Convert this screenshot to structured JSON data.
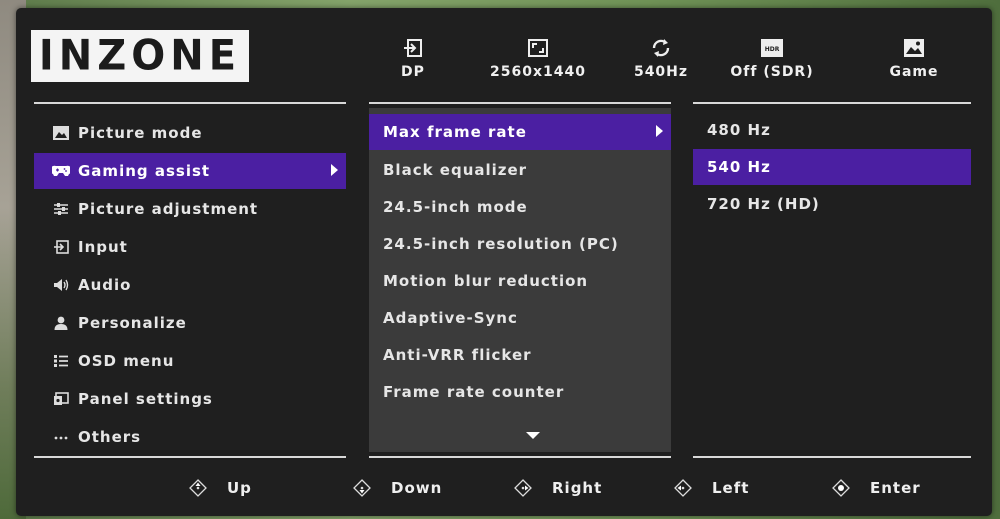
{
  "brand": {
    "logo_text": "INZONE"
  },
  "status_bar": [
    {
      "icon": "input-icon",
      "label": "DP"
    },
    {
      "icon": "resolution-icon",
      "label": "2560x1440"
    },
    {
      "icon": "refresh-rate-icon",
      "label": "540Hz"
    },
    {
      "icon": "hdr-icon",
      "badge": "HDR",
      "label": "Off (SDR)"
    },
    {
      "icon": "picture-mode-icon",
      "label": "Game"
    }
  ],
  "main_menu": {
    "items": [
      {
        "icon": "picture-icon",
        "label": "Picture mode"
      },
      {
        "icon": "gamepad-icon",
        "label": "Gaming assist",
        "selected": true
      },
      {
        "icon": "sliders-icon",
        "label": "Picture adjustment"
      },
      {
        "icon": "input-icon",
        "label": "Input"
      },
      {
        "icon": "speaker-icon",
        "label": "Audio"
      },
      {
        "icon": "person-icon",
        "label": "Personalize"
      },
      {
        "icon": "list-icon",
        "label": "OSD menu"
      },
      {
        "icon": "panel-icon",
        "label": "Panel settings"
      },
      {
        "icon": "more-icon",
        "label": "Others"
      }
    ]
  },
  "sub_menu": {
    "items": [
      {
        "label": "Max frame rate",
        "selected": true
      },
      {
        "label": "Black equalizer"
      },
      {
        "label": "24.5-inch mode"
      },
      {
        "label": "24.5-inch resolution (PC)"
      },
      {
        "label": "Motion blur reduction"
      },
      {
        "label": "Adaptive-Sync"
      },
      {
        "label": "Anti-VRR flicker"
      },
      {
        "label": "Frame rate counter"
      }
    ],
    "more_indicator": "chevron-down-icon"
  },
  "options": {
    "items": [
      {
        "label": "480 Hz"
      },
      {
        "label": "540 Hz",
        "selected": true
      },
      {
        "label": "720 Hz (HD)"
      }
    ]
  },
  "footer": [
    {
      "icon": "dpad-up-icon",
      "label": "Up"
    },
    {
      "icon": "dpad-down-icon",
      "label": "Down"
    },
    {
      "icon": "dpad-right-icon",
      "label": "Right"
    },
    {
      "icon": "dpad-left-icon",
      "label": "Left"
    },
    {
      "icon": "dpad-center-icon",
      "label": "Enter"
    }
  ],
  "colors": {
    "osd_background": "#1f1f1f",
    "submenu_background": "#3b3b3b",
    "selection": "#4b1fa2",
    "text": "#ececec"
  }
}
